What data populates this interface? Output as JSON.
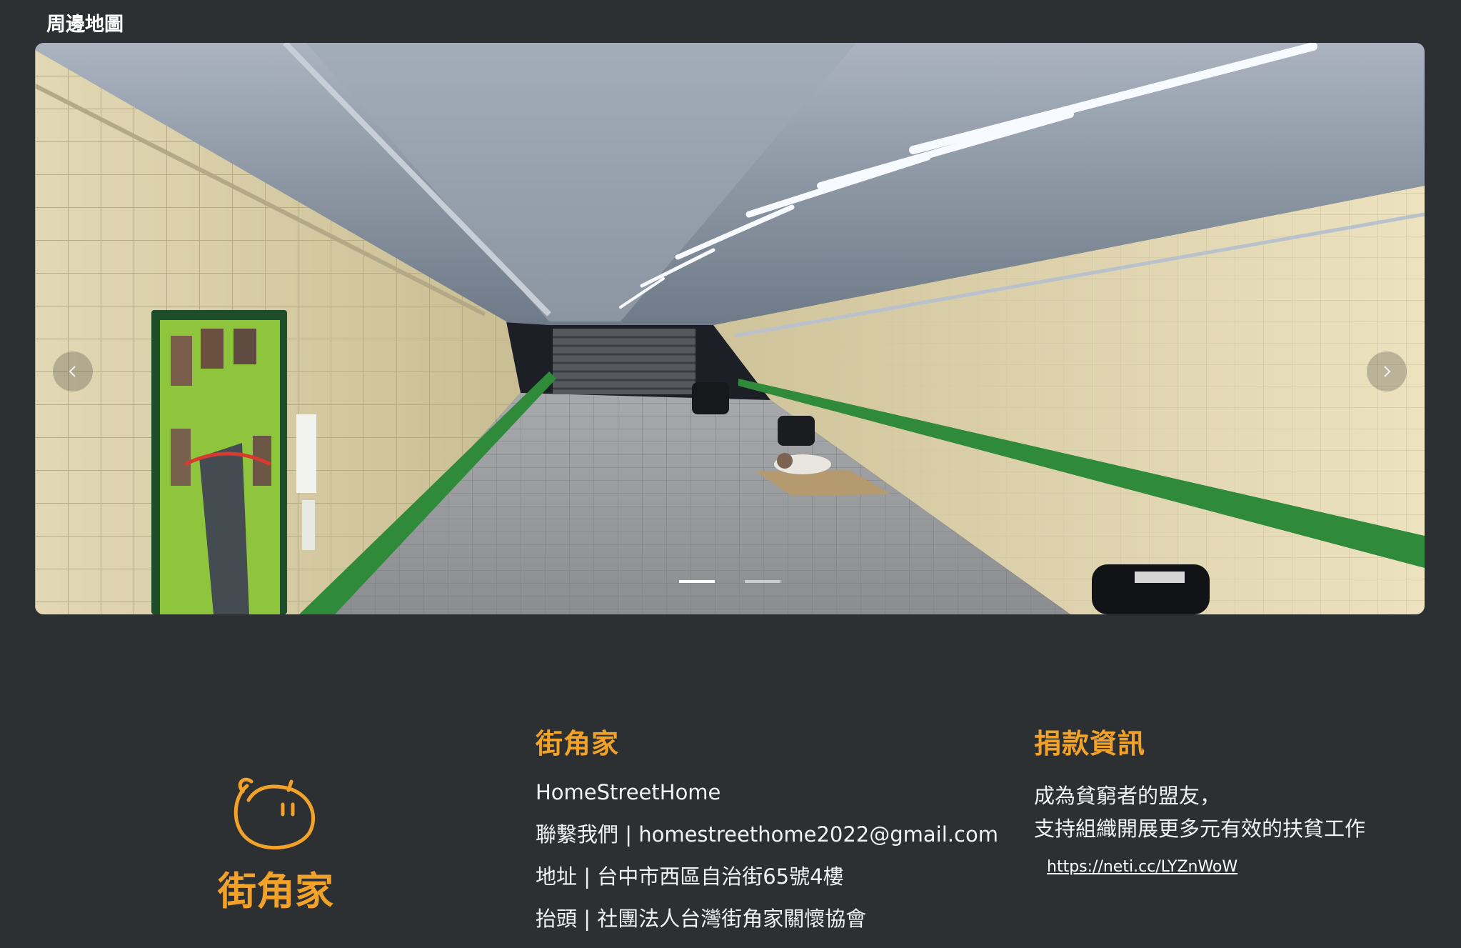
{
  "section": {
    "title": "周邊地圖"
  },
  "carousel": {
    "slide_count": 2,
    "active_slide": 1,
    "prev_icon": "chevron-left-icon",
    "next_icon": "chevron-right-icon"
  },
  "footer": {
    "logo_text": "街角家",
    "about": {
      "heading": "街角家",
      "lines": [
        "HomeStreetHome",
        "聯繫我們 | homestreethome2022@gmail.com",
        "地址 | 台中市西區自治街65號4樓",
        "抬頭 | 社團法人台灣街角家關懷協會"
      ]
    },
    "donate": {
      "heading": "捐款資訊",
      "lines": [
        "成為貧窮者的盟友，",
        "支持組織開展更多元有效的扶貧工作"
      ],
      "link": "https://neti.cc/LYZnWoW"
    }
  },
  "colors": {
    "background": "#2d3033",
    "accent": "#f3a229",
    "text": "#f2f2f2"
  }
}
